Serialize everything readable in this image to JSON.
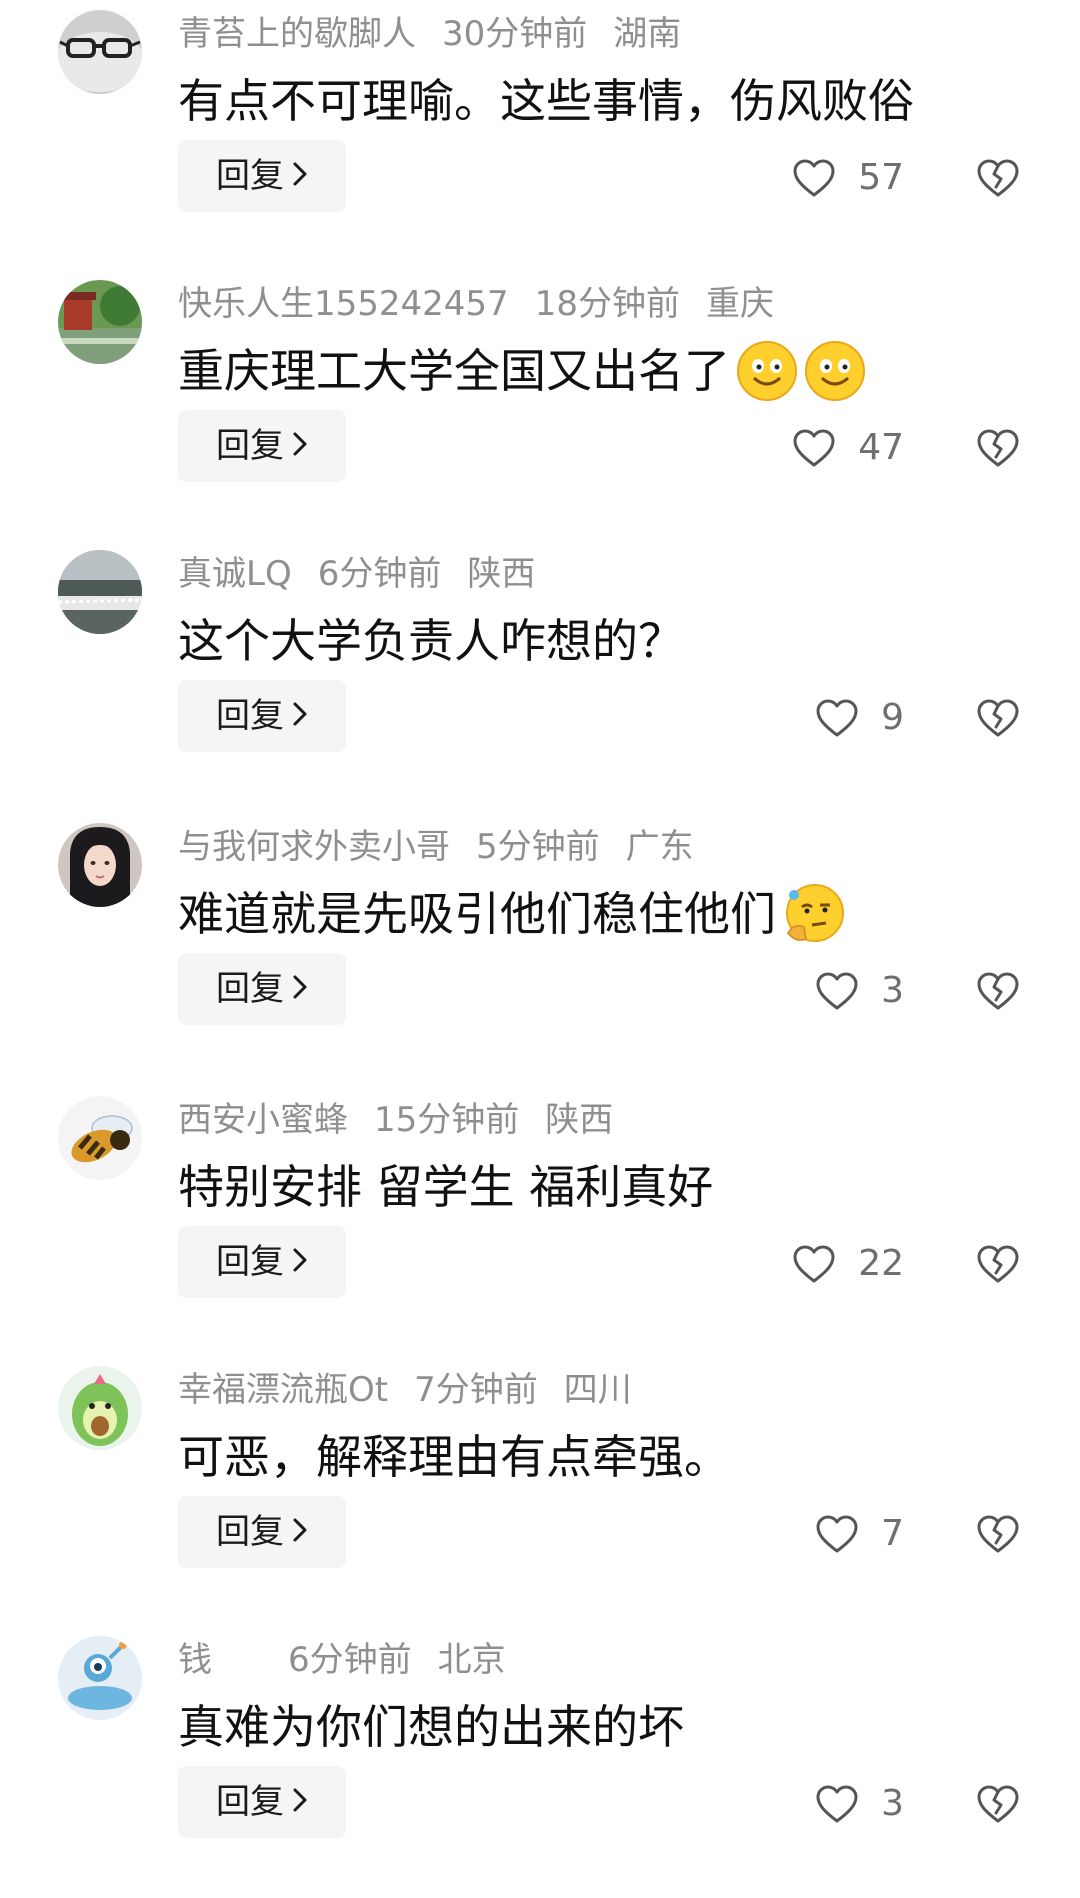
{
  "comments": [
    {
      "username": "青苔上的歇脚人",
      "time": "30分钟前",
      "location": "湖南",
      "text": "有点不可理喻。这些事情，伤风败俗",
      "reply_label": "回复",
      "likes": "57",
      "avatar_icon": "glasses-avatar",
      "emojis": []
    },
    {
      "username": "快乐人生155242457",
      "time": "18分钟前",
      "location": "重庆",
      "text": "重庆理工大学全国又出名了",
      "reply_label": "回复",
      "likes": "47",
      "avatar_icon": "garden-avatar",
      "emojis": [
        "smile-emoji",
        "smile-emoji"
      ]
    },
    {
      "username": "真诚LQ",
      "time": "6分钟前",
      "location": "陕西",
      "text": "这个大学负责人咋想的？",
      "reply_label": "回复",
      "likes": "9",
      "avatar_icon": "landscape-avatar",
      "emojis": []
    },
    {
      "username": "与我何求外卖小哥",
      "time": "5分钟前",
      "location": "广东",
      "text": "难道就是先吸引他们稳住他们",
      "reply_label": "回复",
      "likes": "3",
      "avatar_icon": "woman-avatar",
      "emojis": [
        "thinking-emoji"
      ]
    },
    {
      "username": "西安小蜜蜂",
      "time": "15分钟前",
      "location": "陕西",
      "text": "特别安排 留学生 福利真好",
      "reply_label": "回复",
      "likes": "22",
      "avatar_icon": "bee-avatar",
      "emojis": []
    },
    {
      "username": "幸福漂流瓶Ot",
      "time": "7分钟前",
      "location": "四川",
      "text": "可恶，解释理由有点牵强。",
      "reply_label": "回复",
      "likes": "7",
      "avatar_icon": "avocado-avatar",
      "emojis": []
    },
    {
      "username": "钱",
      "time": "6分钟前",
      "location": "北京",
      "text": "真难为你们想的出来的坏",
      "reply_label": "回复",
      "likes": "3",
      "avatar_icon": "alien-avatar",
      "emojis": []
    }
  ],
  "colors": {
    "meta_text": "#8f8f8f",
    "body_text": "#111111",
    "reply_bg": "#f5f5f5",
    "icon_stroke": "#555555"
  }
}
